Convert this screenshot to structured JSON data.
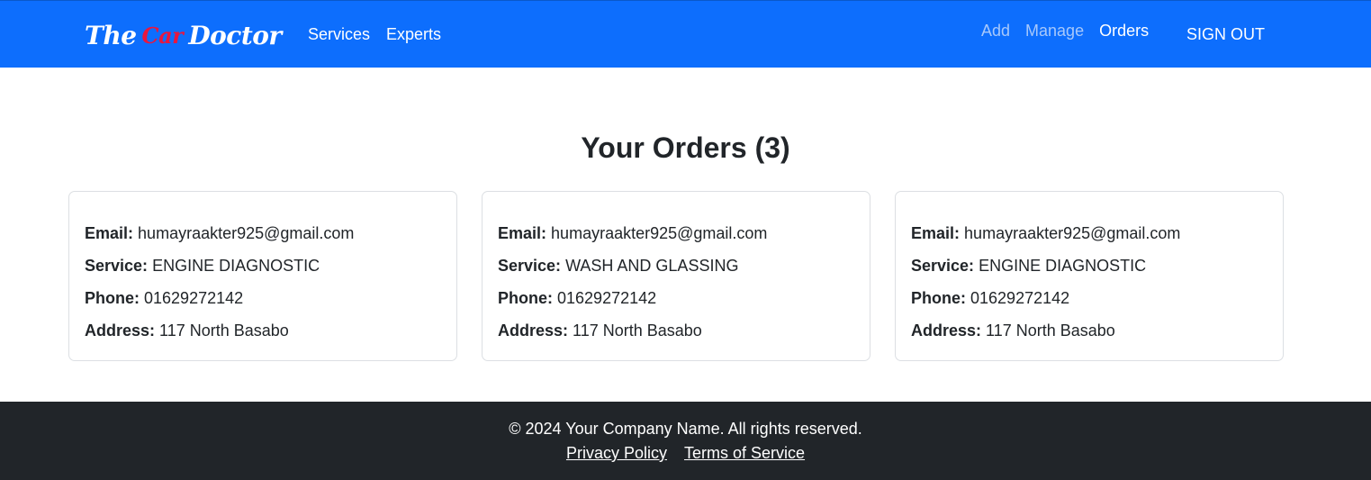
{
  "nav": {
    "brand_left": "The",
    "brand_mid": "Car",
    "brand_right": "Doctor",
    "left_links": [
      "Services",
      "Experts"
    ],
    "right_links": [
      "Add",
      "Manage",
      "Orders"
    ],
    "signout": "SIGN OUT"
  },
  "main": {
    "title": "Your Orders (3)",
    "labels": {
      "email": "Email:",
      "service": "Service:",
      "phone": "Phone:",
      "address": "Address:"
    },
    "orders": [
      {
        "email": "humayraakter925@gmail.com",
        "service": "ENGINE DIAGNOSTIC",
        "phone": "01629272142",
        "address": "117 North Basabo"
      },
      {
        "email": "humayraakter925@gmail.com",
        "service": "WASH AND GLASSING",
        "phone": "01629272142",
        "address": "117 North Basabo"
      },
      {
        "email": "humayraakter925@gmail.com",
        "service": "ENGINE DIAGNOSTIC",
        "phone": "01629272142",
        "address": "117 North Basabo"
      }
    ]
  },
  "footer": {
    "copyright": "© 2024 Your Company Name. All rights reserved.",
    "privacy": "Privacy Policy",
    "terms": "Terms of Service"
  },
  "colors": {
    "navbar": "#0d6efd",
    "footer": "#212529",
    "brand_accent": "#e8173f"
  }
}
